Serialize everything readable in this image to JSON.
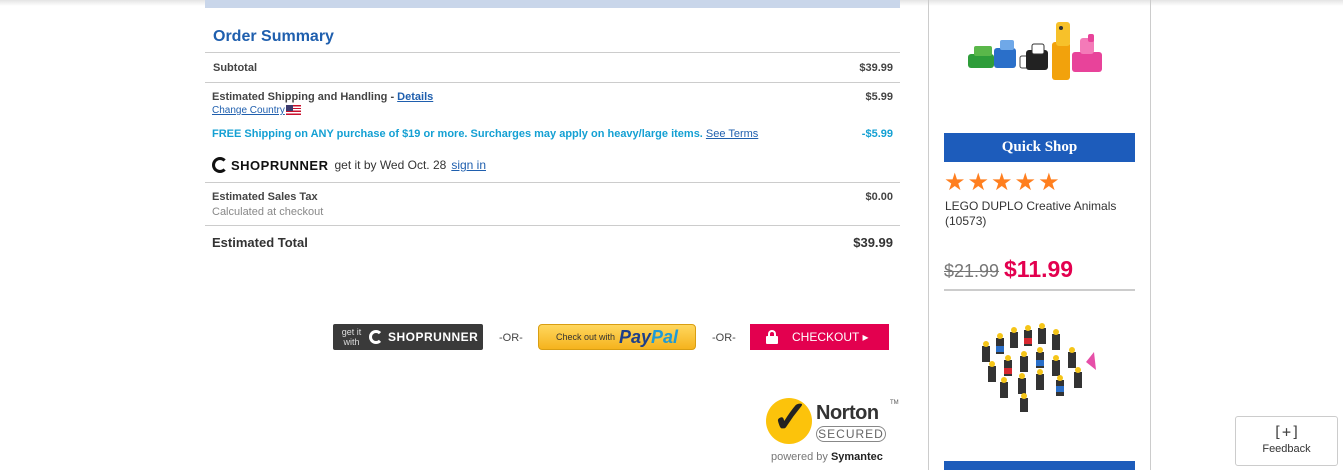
{
  "summary": {
    "title": "Order Summary",
    "subtotal_label": "Subtotal",
    "subtotal_value": "$39.99",
    "shipping_label": "Estimated Shipping and Handling - ",
    "shipping_details_link": "Details",
    "change_country_link": "Change Country",
    "shipping_value": "$5.99",
    "free_shipping_text": "FREE Shipping on ANY purchase of $19 or more. Surcharges may apply on heavy/large items. ",
    "see_terms_link": "See Terms",
    "free_shipping_value": "-$5.99",
    "shoprunner_brand": "SHOPRUNNER",
    "shoprunner_text": "get it by Wed Oct. 28",
    "shoprunner_signin": "sign in",
    "tax_label": "Estimated Sales Tax",
    "tax_sub": "Calculated at checkout",
    "tax_value": "$0.00",
    "total_label": "Estimated Total",
    "total_value": "$39.99"
  },
  "checkout": {
    "shoprunner_get": "get it with",
    "shoprunner_name": "SHOPRUNNER",
    "or1": "-OR-",
    "paypal_prefix": "Check out with",
    "paypal_a": "Pay",
    "paypal_b": "Pal",
    "or2": "-OR-",
    "checkout_label": "CHECKOUT ▸"
  },
  "norton": {
    "brand": "Norton",
    "tm": "TM",
    "secured": "SECURED",
    "powered": "powered by ",
    "symantec": "Symantec"
  },
  "sidebar": {
    "quick_shop": "Quick Shop",
    "rating": 5,
    "product_name": "LEGO DUPLO Creative Animals (10573)",
    "price_old": "$21.99",
    "price_new": "$11.99"
  },
  "feedback": {
    "icon": "[+]",
    "label": "Feedback"
  },
  "colors": {
    "accent_blue": "#1d5cbb",
    "sale_red": "#e3004f",
    "free_ship_blue": "#14a0d3",
    "star_orange": "#ff7f1f"
  }
}
